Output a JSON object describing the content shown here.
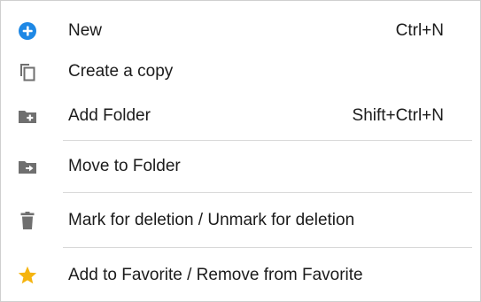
{
  "menu": {
    "items": [
      {
        "label": "New",
        "shortcut": "Ctrl+N",
        "icon": "plus-circle-icon"
      },
      {
        "label": "Create a copy",
        "icon": "copy-icon"
      },
      {
        "label": "Add Folder",
        "shortcut": "Shift+Ctrl+N",
        "icon": "folder-add-icon"
      },
      {
        "label": "Move to Folder",
        "icon": "folder-move-icon"
      },
      {
        "label": "Mark for deletion / Unmark for deletion",
        "icon": "trash-icon"
      },
      {
        "label": "Add to Favorite / Remove from Favorite",
        "icon": "star-icon"
      }
    ]
  },
  "colors": {
    "accent_blue": "#1E88E5",
    "icon_gray": "#6f6f6f",
    "star_gold": "#F5B40F",
    "separator": "#d8d8d8",
    "text": "#1b1b1b"
  }
}
